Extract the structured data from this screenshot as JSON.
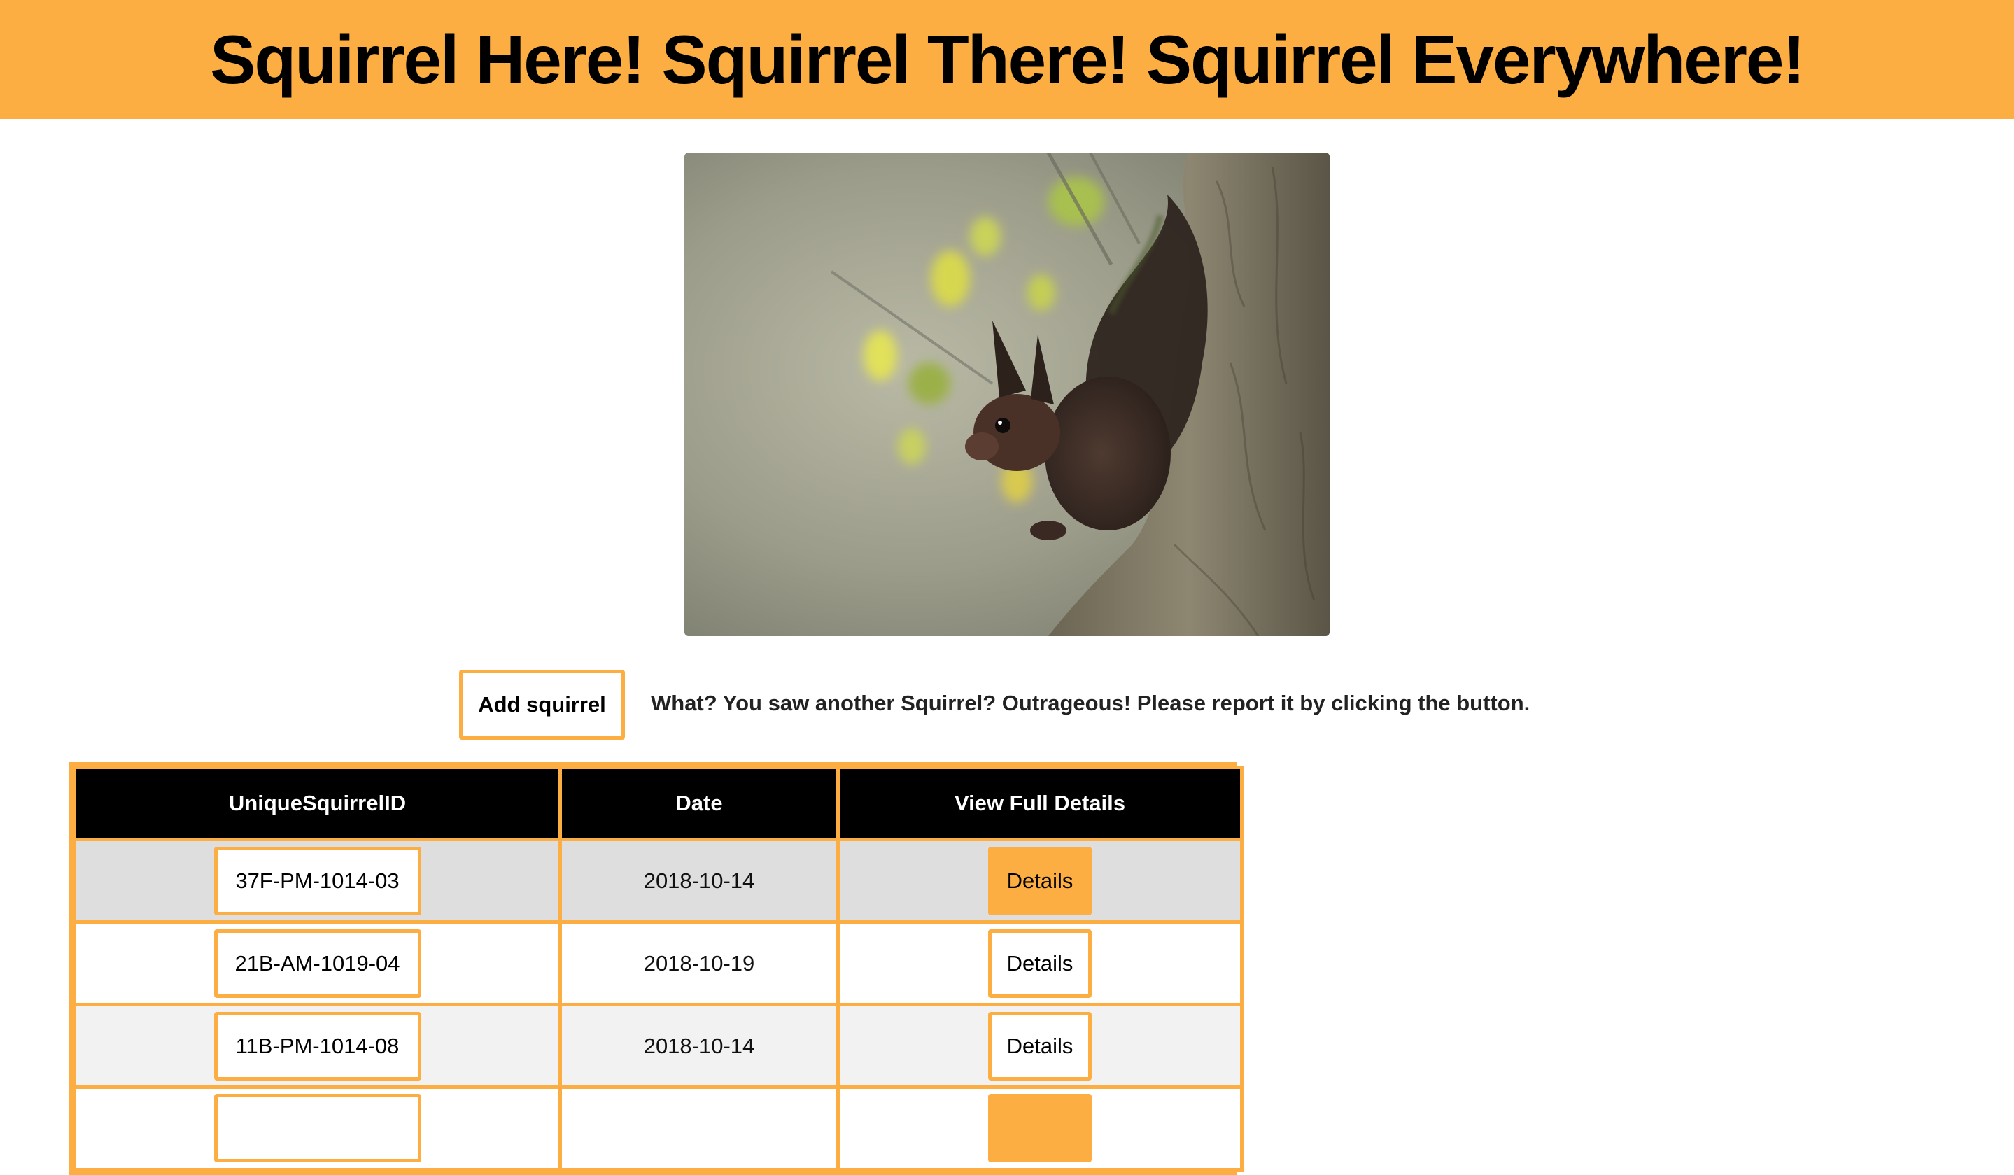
{
  "header": {
    "title": "Squirrel Here! Squirrel There! Squirrel Everywhere!"
  },
  "hero": {
    "image_subject": "squirrel-on-tree-photo"
  },
  "actions": {
    "add_label": "Add squirrel",
    "prompt": "What? You saw another Squirrel? Outrageous! Please report it by clicking the button."
  },
  "table": {
    "headers": [
      "UniqueSquirrelID",
      "Date",
      "View Full Details"
    ],
    "rows": [
      {
        "id": "37F-PM-1014-03",
        "date": "2018-10-14",
        "details": "Details"
      },
      {
        "id": "21B-AM-1019-04",
        "date": "2018-10-19",
        "details": "Details"
      },
      {
        "id": "11B-PM-1014-08",
        "date": "2018-10-14",
        "details": "Details"
      },
      {
        "id": "",
        "date": "",
        "details": ""
      }
    ]
  },
  "colors": {
    "accent": "#fcae43",
    "header_bg": "#000000",
    "row_hover": "#dedede",
    "row_alt": "#f2f2f2"
  }
}
